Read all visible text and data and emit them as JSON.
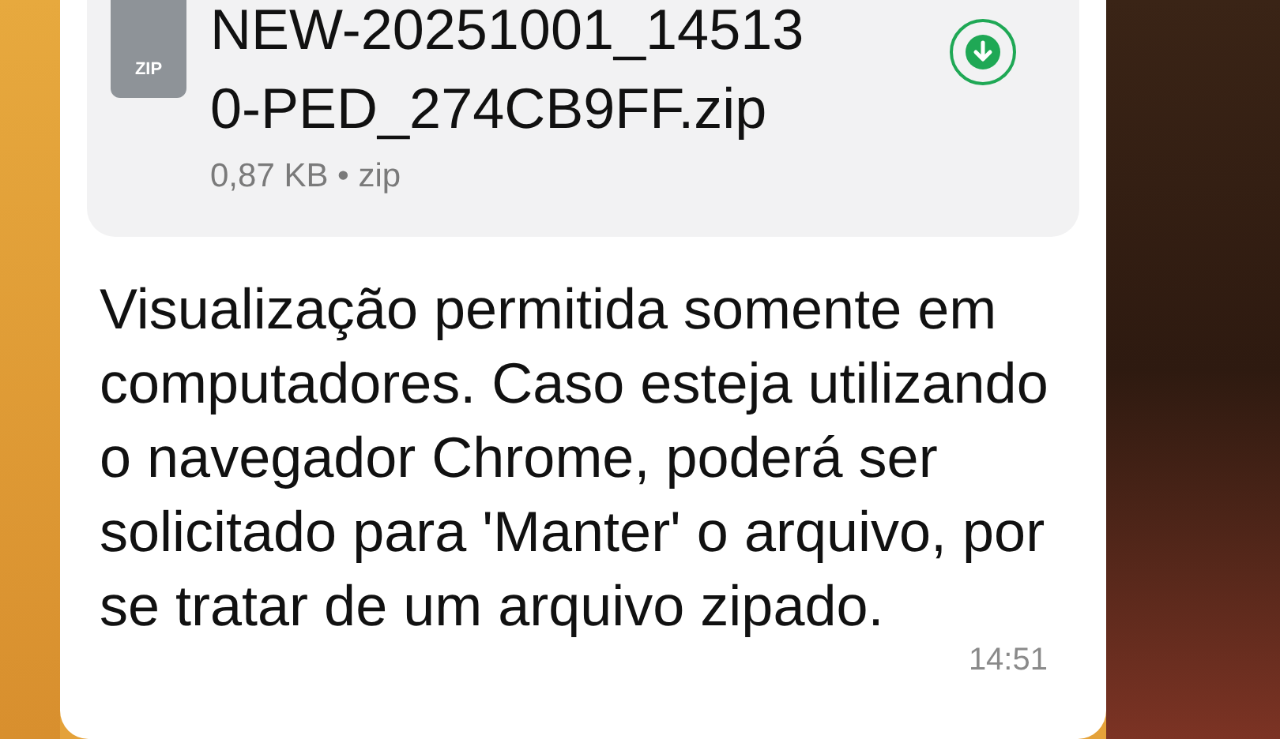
{
  "attachment": {
    "file_name": "NEW-20251001_145130-PED_274CB9FF.zip",
    "icon_label": "ZIP",
    "details": "0,87 KB • zip"
  },
  "message": {
    "text": "Visualização permitida somente em computadores. Caso esteja utilizando o navegador Chrome, poderá ser solicitado para 'Manter' o arquivo, por se tratar de um arquivo zipado.",
    "time": "14:51"
  }
}
